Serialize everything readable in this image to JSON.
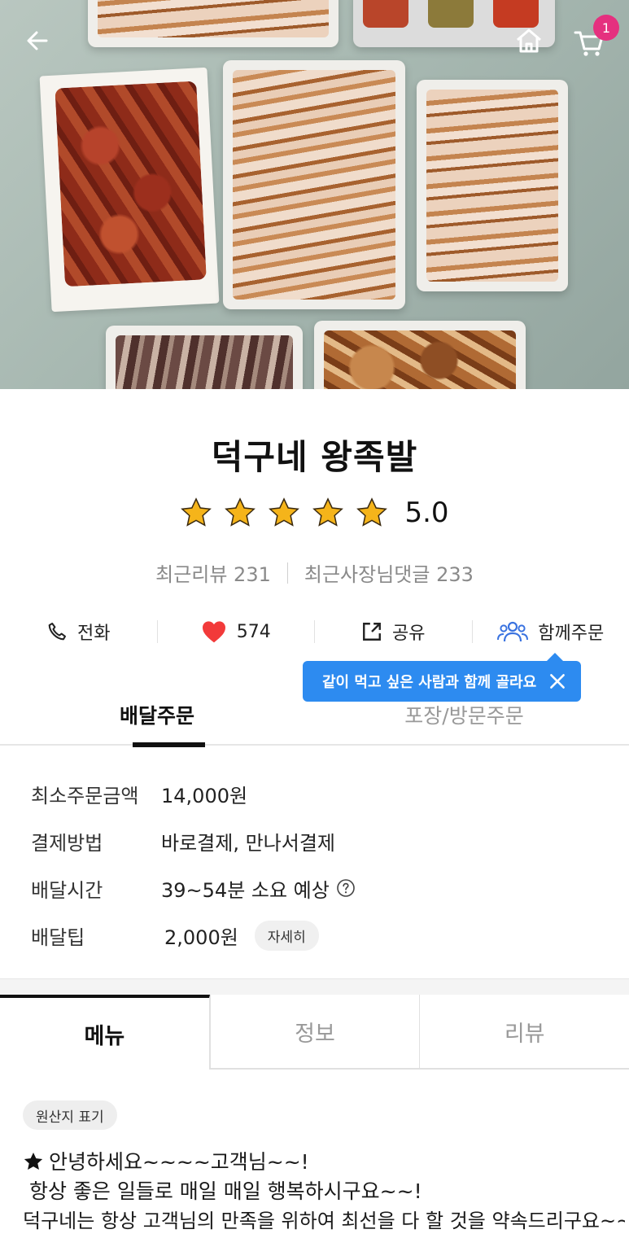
{
  "header": {
    "back_icon": "arrow-left-icon",
    "home_icon": "home-icon",
    "cart_icon": "cart-icon",
    "cart_count": "1"
  },
  "store": {
    "name": "덕구네 왕족발",
    "rating": "5.0",
    "stars": 5,
    "star_color": "#f5b41a",
    "recent_reviews_label": "최근리뷰 231",
    "recent_owner_comments_label": "최근사장님댓글 233"
  },
  "actions": {
    "call_label": "전화",
    "like_count": "574",
    "share_label": "공유",
    "group_order_label": "함께주문"
  },
  "tooltip": {
    "text": "같이 먹고 싶은 사람과 함께 골라요"
  },
  "order_tabs": [
    {
      "label": "배달주문",
      "active": true
    },
    {
      "label": "포장/방문주문",
      "active": false
    }
  ],
  "info": {
    "min_order": {
      "label": "최소주문금액",
      "value": "14,000원"
    },
    "payment": {
      "label": "결제방법",
      "value": "바로결제, 만나서결제"
    },
    "delivery_time": {
      "label": "배달시간",
      "value": "39~54분 소요 예상"
    },
    "delivery_tip": {
      "label": "배달팁",
      "value": "2,000원",
      "detail_label": "자세히"
    }
  },
  "menu_tabs": [
    {
      "label": "메뉴",
      "active": true
    },
    {
      "label": "정보",
      "active": false
    },
    {
      "label": "리뷰",
      "active": false
    }
  ],
  "origin_chip": "원산지 표기",
  "notice": {
    "line1": "안녕하세요~~~~고객님~~!",
    "line2": " 항상 좋은 일들로 매일 매일 행복하시구요~~!",
    "line3": "덕구네는 항상 고객님의 만족을 위하여 최선을 다 할 것을 약속드리구요~~"
  },
  "colors": {
    "accent_blue": "#2d8bf0",
    "badge_pink": "#e5307f",
    "heart_red": "#f23a3a",
    "group_icon_blue": "#3a73e0"
  }
}
